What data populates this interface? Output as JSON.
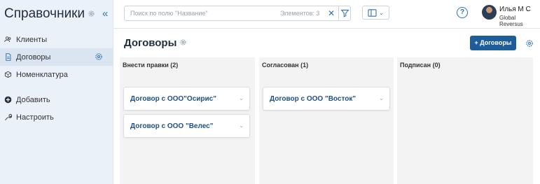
{
  "sidebar": {
    "title": "Справочники",
    "items": [
      {
        "label": "Клиенты",
        "icon": "users-icon"
      },
      {
        "label": "Договоры",
        "icon": "document-icon",
        "active": true
      },
      {
        "label": "Номенклатура",
        "icon": "box-icon"
      }
    ],
    "actions": [
      {
        "label": "Добавить",
        "icon": "add-circle-icon"
      },
      {
        "label": "Настроить",
        "icon": "wrench-icon"
      }
    ]
  },
  "search": {
    "placeholder": "Поиск по полю \"Название\"",
    "count_label": "Элементов: 3"
  },
  "user": {
    "name": "Илья М С",
    "org": "Global Reversus"
  },
  "main": {
    "title": "Договоры",
    "add_button": "+ Договоры"
  },
  "columns": [
    {
      "title": "Внести правки (2)",
      "cards": [
        "Договор с ООО\"Осирис\"",
        "Договор с ООО \"Велес\""
      ]
    },
    {
      "title": "Согласован (1)",
      "cards": [
        "Договор с ООО \"Восток\""
      ]
    },
    {
      "title": "Подписан (0)",
      "cards": []
    }
  ],
  "colors": {
    "accent": "#1e5c9a",
    "link": "#1d4f86",
    "sidebar_bg": "#ebf1f8",
    "column_bg": "#f3f3f3"
  }
}
